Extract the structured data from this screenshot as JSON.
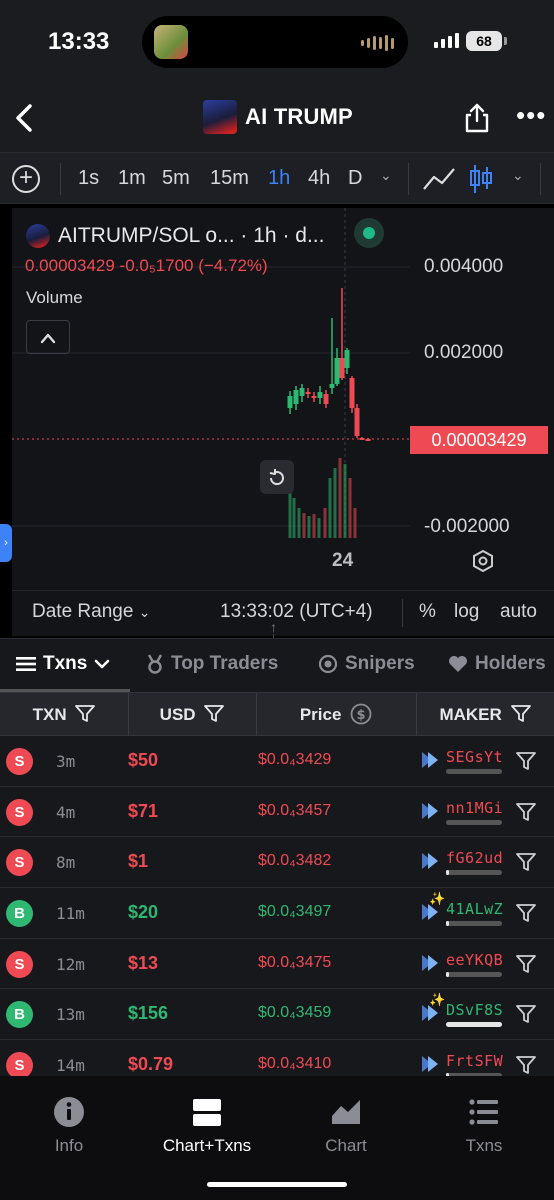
{
  "status_bar": {
    "time": "13:33",
    "battery": "68"
  },
  "header": {
    "title": "AI TRUMP"
  },
  "timeframes": {
    "items": [
      "1s",
      "1m",
      "5m",
      "15m",
      "1h",
      "4h",
      "D"
    ],
    "active": "1h"
  },
  "chart": {
    "symbol_line": "AITRUMP/SOL o... · 1h · d...",
    "ohlc_line": "0.00003429  -0.0₅1700 (−4.72%)",
    "volume_label": "Volume",
    "y_labels": [
      "0.004000",
      "0.002000",
      "-0.002000"
    ],
    "last_price": "0.00003429",
    "x_label": "24",
    "colors": {
      "up": "#2eb872",
      "down": "#ef4a53"
    }
  },
  "chart_footer": {
    "date_range": "Date Range",
    "clock": "13:33:02 (UTC+4)",
    "percent": "%",
    "log": "log",
    "auto": "auto"
  },
  "tabs": [
    {
      "label": "Txns"
    },
    {
      "label": "Top Traders"
    },
    {
      "label": "Snipers"
    },
    {
      "label": "Holders"
    }
  ],
  "table": {
    "columns": [
      "TXN",
      "USD",
      "Price",
      "MAKER"
    ],
    "rows": [
      {
        "side": "S",
        "age": "3m",
        "usd": "$50",
        "price": "$0.0₄3429",
        "maker": "SEGsYt",
        "maker_fill": 0.0,
        "sparkle": false
      },
      {
        "side": "S",
        "age": "4m",
        "usd": "$71",
        "price": "$0.0₄3457",
        "maker": "nn1MGi",
        "maker_fill": 0.0,
        "sparkle": false
      },
      {
        "side": "S",
        "age": "8m",
        "usd": "$1",
        "price": "$0.0₄3482",
        "maker": "fG62ud",
        "maker_fill": 0.05,
        "sparkle": false
      },
      {
        "side": "B",
        "age": "11m",
        "usd": "$20",
        "price": "$0.0₄3497",
        "maker": "41ALwZ",
        "maker_fill": 0.05,
        "sparkle": true
      },
      {
        "side": "S",
        "age": "12m",
        "usd": "$13",
        "price": "$0.0₄3475",
        "maker": "eeYKQB",
        "maker_fill": 0.05,
        "sparkle": false
      },
      {
        "side": "B",
        "age": "13m",
        "usd": "$156",
        "price": "$0.0₄3459",
        "maker": "DSvF8S",
        "maker_fill": 1.0,
        "sparkle": true
      },
      {
        "side": "S",
        "age": "14m",
        "usd": "$0.79",
        "price": "$0.0₄3410",
        "maker": "FrtSFW",
        "maker_fill": 0.05,
        "sparkle": false
      }
    ]
  },
  "bottom_nav": [
    {
      "label": "Info"
    },
    {
      "label": "Chart+Txns"
    },
    {
      "label": "Chart"
    },
    {
      "label": "Txns"
    }
  ]
}
